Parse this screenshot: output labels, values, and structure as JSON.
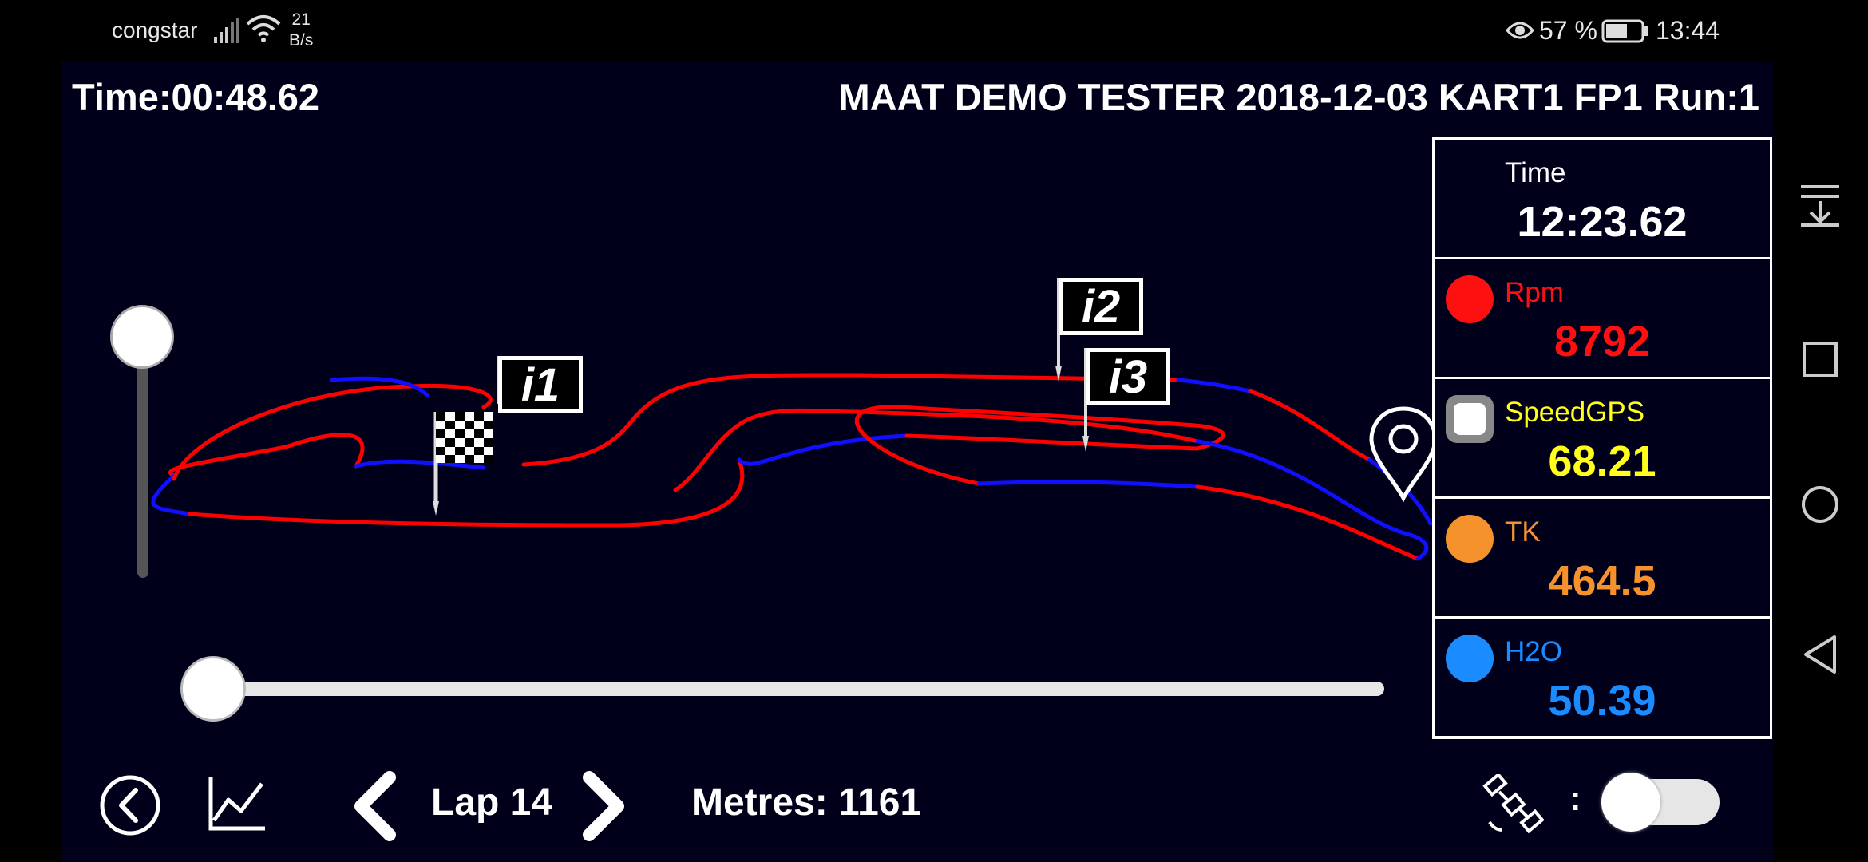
{
  "status_bar": {
    "carrier": "congstar",
    "net_speed_value": "21",
    "net_speed_unit": "B/s",
    "battery": "57 %",
    "clock": "13:44"
  },
  "header": {
    "elapsed": "Time:00:48.62",
    "session": "MAAT DEMO TESTER 2018-12-03 KART1 FP1 Run:1"
  },
  "markers": {
    "i1": "i1",
    "i2": "i2",
    "i3": "i3"
  },
  "panel": [
    {
      "label": "Time",
      "value": "12:23.62",
      "color": "#ffffff",
      "indicator": "none"
    },
    {
      "label": "Rpm",
      "value": "8792",
      "color": "#ff1010",
      "indicator": "dot"
    },
    {
      "label": "SpeedGPS",
      "value": "68.21",
      "color": "#ffff1a",
      "indicator": "square"
    },
    {
      "label": "TK",
      "value": "464.5",
      "color": "#f5922b",
      "indicator": "dot"
    },
    {
      "label": "H2O",
      "value": "50.39",
      "color": "#1a8cff",
      "indicator": "dot"
    }
  ],
  "bottom": {
    "lap": "Lap 14",
    "metres": "Metres: 1161",
    "colon": ":"
  },
  "icons": {
    "back": "circle-back-icon",
    "chart": "line-chart-icon",
    "prev": "chevron-left-icon",
    "next": "chevron-right-icon",
    "satellite": "satellite-icon",
    "location": "location-pin-icon",
    "flag": "checkered-flag-icon"
  },
  "colors": {
    "background": "#00001b",
    "track_red": "#ff0000",
    "track_blue": "#1010ff"
  }
}
